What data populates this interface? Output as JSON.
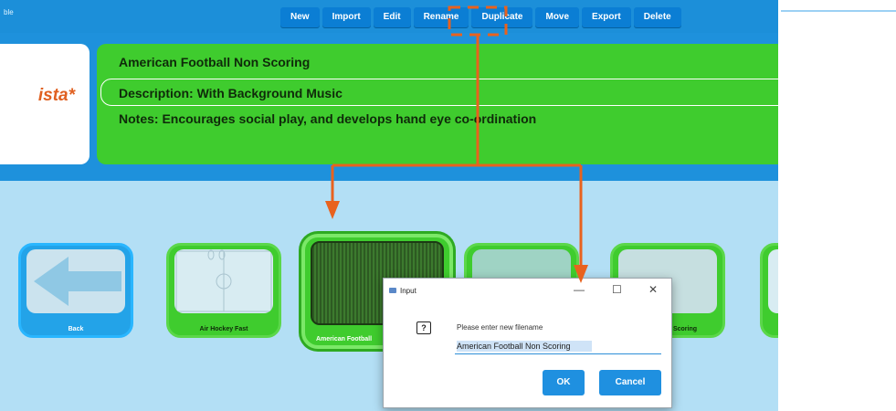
{
  "app": {
    "title": "ble"
  },
  "toolbar": {
    "buttons": [
      {
        "label": "New"
      },
      {
        "label": "Import"
      },
      {
        "label": "Edit"
      },
      {
        "label": "Rename"
      },
      {
        "label": "Duplicate"
      },
      {
        "label": "Move"
      },
      {
        "label": "Export"
      },
      {
        "label": "Delete"
      }
    ]
  },
  "logo": {
    "text": "ista*"
  },
  "info": {
    "name": "American Football Non Scoring",
    "description": "Description: With Background Music",
    "notes": "Notes: Encourages social play, and develops hand eye co-ordination"
  },
  "tiles": [
    {
      "label": "Back"
    },
    {
      "label": "Air Hockey Fast"
    },
    {
      "label": "American Football"
    },
    {
      "label": ""
    },
    {
      "label": "Scoring"
    },
    {
      "label": ""
    }
  ],
  "dialog": {
    "title": "Input",
    "minimize": "—",
    "maximize": "☐",
    "close": "✕",
    "prompt": "Please enter new filename",
    "value": "American Football Non Scoring",
    "ok_label": "OK",
    "cancel_label": "Cancel"
  },
  "colors": {
    "annotation": "#e8621e",
    "accent": "#1f90e0",
    "panel": "#3fcc2e"
  },
  "icons": {
    "question": "question-icon",
    "back_arrow": "back-arrow-icon"
  }
}
